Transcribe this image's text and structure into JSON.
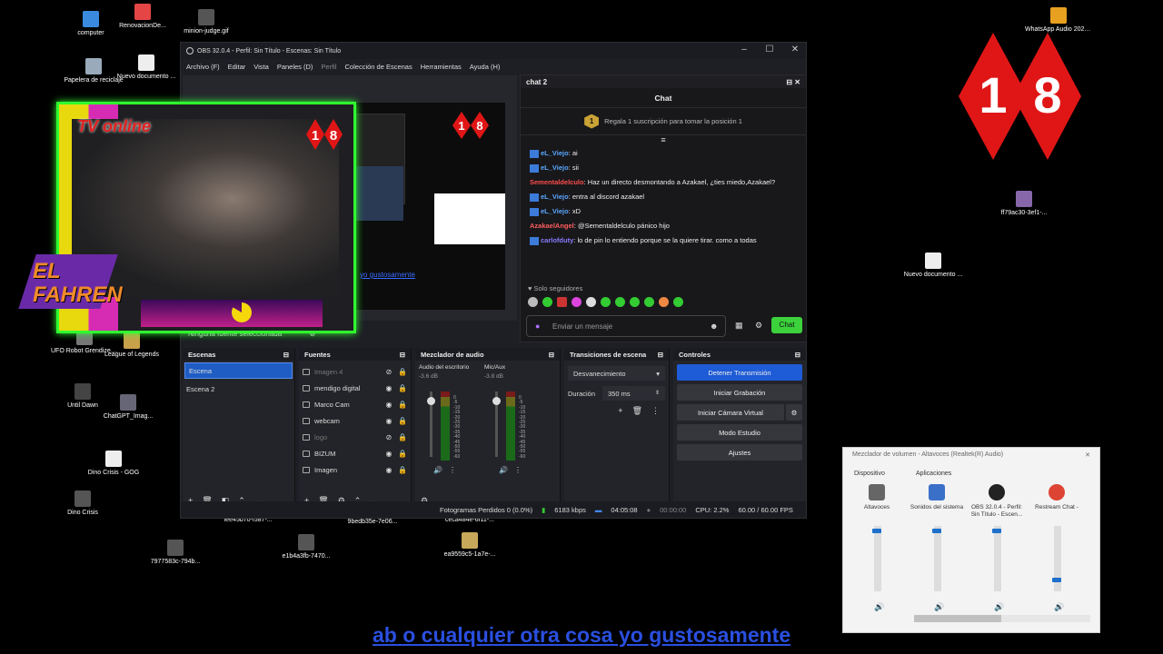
{
  "desktop_icons": [
    {
      "label": "computer",
      "color": "#3a8be0"
    },
    {
      "label": "RenovacionDe...",
      "color": "#e54545"
    },
    {
      "label": "minion-judge.gif",
      "color": "#555"
    },
    {
      "label": "Papelera de reciclaje",
      "color": "#9ab"
    },
    {
      "label": "Nuevo documento ...",
      "color": "#eee"
    },
    {
      "label": "UFO Robot Grendizer - T...",
      "color": "#777"
    },
    {
      "label": "League of Legends",
      "color": "#c8a14a"
    },
    {
      "label": "Until Dawn",
      "color": "#444"
    },
    {
      "label": "ChatGPT_Imag...",
      "color": "#667"
    },
    {
      "label": "Dino Crisis - GOG",
      "color": "#eee"
    },
    {
      "label": "Dino Crisis",
      "color": "#555"
    },
    {
      "label": "fee45b70-f587-...",
      "color": "#555"
    },
    {
      "label": "9bedb35e-7e06...",
      "color": "#555"
    },
    {
      "label": "ceca484e-6f11-...",
      "color": "#555"
    },
    {
      "label": "7977583c-794b...",
      "color": "#555"
    },
    {
      "label": "e1b4a3fb-7470...",
      "color": "#555"
    },
    {
      "label": "ea9559c5-1a7e-...",
      "color": "#c7a85a"
    },
    {
      "label": "WhatsApp Audio 2025-02-28 at 2...",
      "color": "#e8a020"
    },
    {
      "label": "ff79ac30-3ef1-...",
      "color": "#8866aa"
    },
    {
      "label": "Nuevo documento ...",
      "color": "#eee"
    }
  ],
  "obs": {
    "title": "OBS 32.0.4 - Perfil: Sin Título - Escenas: Sin Título",
    "menu": [
      "Archivo (F)",
      "Editar",
      "Vista",
      "Paneles (D)",
      "Perfil",
      "Colección de Escenas",
      "Herramientas",
      "Ayuda (H)"
    ],
    "no_source": "Ninguna fuente seleccionada",
    "scenes_title": "Escenas",
    "scenes": [
      "Escena",
      "Escena 2"
    ],
    "sources_title": "Fuentes",
    "sources": [
      {
        "name": "Imagen 4",
        "dim": true
      },
      {
        "name": "mendigo digital",
        "dim": false
      },
      {
        "name": "Marco Cam",
        "dim": false
      },
      {
        "name": "webcam",
        "dim": false
      },
      {
        "name": "logo",
        "dim": true
      },
      {
        "name": "BIZUM",
        "dim": false
      },
      {
        "name": "Imagen",
        "dim": false
      }
    ],
    "mixer_title": "Mezclador de audio",
    "mixer_channels": [
      {
        "name": "Audio del escritorio",
        "db": "-3.6 dB"
      },
      {
        "name": "Mic/Aux",
        "db": "-3.8 dB"
      }
    ],
    "meter_ticks": [
      "0",
      "-5",
      "-10",
      "-15",
      "-20",
      "-25",
      "-30",
      "-35",
      "-40",
      "-45",
      "-50",
      "-55",
      "-60"
    ],
    "transitions_title": "Transiciones de escena",
    "transition": "Desvanecimiento",
    "duration_label": "Duración",
    "duration_value": "350 ms",
    "controls_title": "Controles",
    "controls": [
      "Detener Transmisión",
      "Iniciar Grabación",
      "Iniciar Cámara Virtual",
      "Modo Estudio",
      "Ajustes"
    ],
    "status": {
      "frames": "Fotogramas Perdidos 0 (0.0%)",
      "bitrate": "6183 kbps",
      "stream_time": "04:05:08",
      "rec_time": "00:00:00",
      "cpu": "CPU: 2.2%",
      "fps": "60.00 / 60.00 FPS"
    }
  },
  "overlay": {
    "tv_online": "TV online",
    "badge_18": [
      "1",
      "8"
    ],
    "fahren": "EL FAHREN",
    "preview_link": "yo gustosamente"
  },
  "chat": {
    "dock_title": "chat 2",
    "title": "Chat",
    "gift_rank": "1",
    "gift_text": "Regala 1 suscripción para tomar la posición 1",
    "messages": [
      {
        "user": "eL_Viejo",
        "text": "ai",
        "cls": "u1",
        "badge": true
      },
      {
        "user": "eL_Viejo",
        "text": "sii",
        "cls": "u1",
        "badge": true
      },
      {
        "user": "Sementaldelculo",
        "text": "Haz un directo desmontando a Azakael, ¿ties miedo,Azakael?",
        "cls": "u2",
        "badge": false
      },
      {
        "user": "eL_Viejo",
        "text": "entra al discord azakael",
        "cls": "u1",
        "badge": true
      },
      {
        "user": "eL_Viejo",
        "text": "xD",
        "cls": "u1",
        "badge": true
      },
      {
        "user": "AzakaelAngel",
        "text": "@Sementaldelculo pánico hijo",
        "cls": "u3",
        "badge": false
      },
      {
        "user": "carlofduty",
        "text": "lo de pin lo entiendo porque se la quiere tirar. como a todas",
        "cls": "u4",
        "badge": true
      }
    ],
    "followers_only": "Solo seguidores",
    "input_placeholder": "Enviar un mensaje",
    "send_label": "Chat"
  },
  "volume_mixer": {
    "title": "Mezclador de volumen - Altavoces (Realtek(R) Audio)",
    "device_header": "Dispositivo",
    "apps_header": "Aplicaciones",
    "columns": [
      {
        "label": "Altavoces",
        "level": 0.95
      },
      {
        "label": "Sonidos del sistema",
        "level": 0.95
      },
      {
        "label": "OBS 32.0.4 - Perfil: Sin Título - Escen...",
        "level": 0.95
      },
      {
        "label": "Restream Chat -",
        "level": 0.15
      }
    ]
  },
  "big_badge": [
    "1",
    "8"
  ],
  "subtitle": "ab o cualquier otra cosa yo gustosamente"
}
